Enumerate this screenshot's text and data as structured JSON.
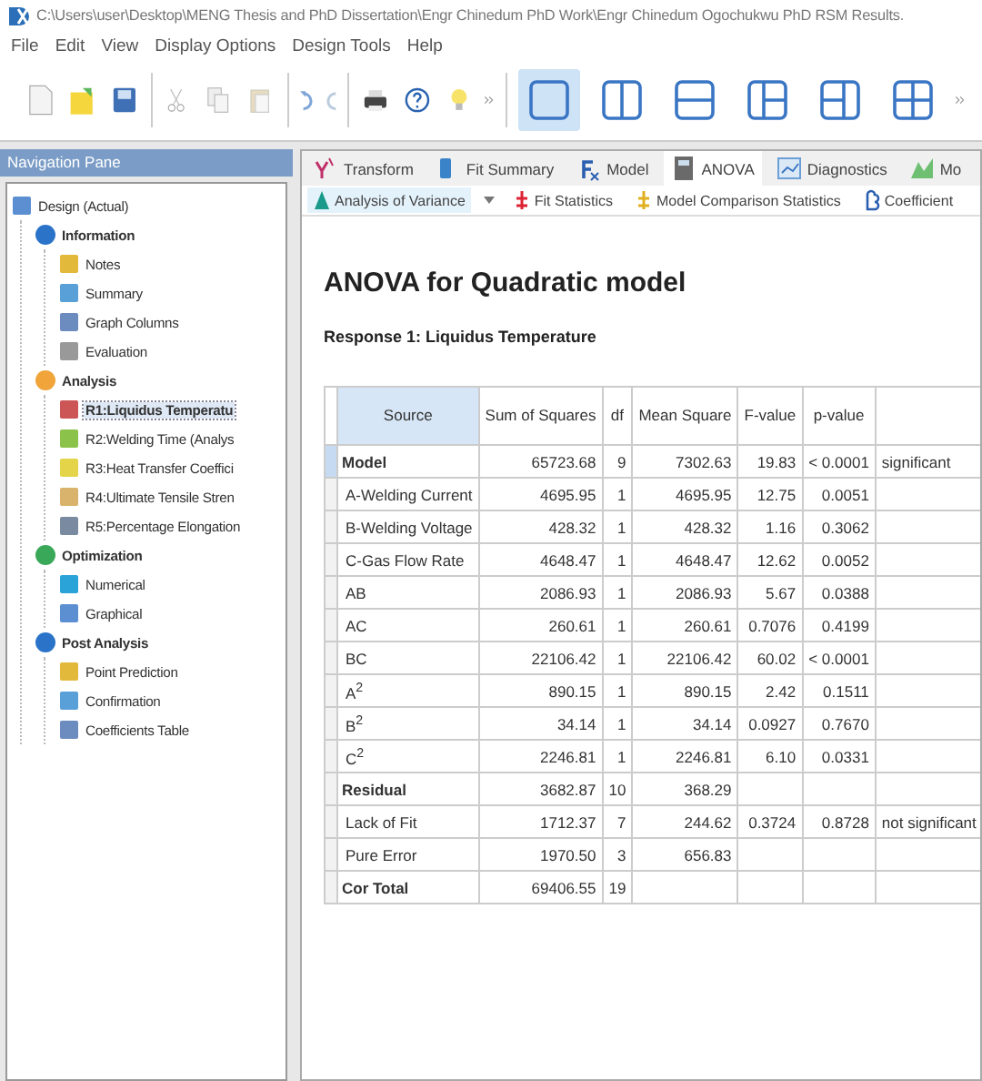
{
  "window": {
    "title": "C:\\Users\\user\\Desktop\\MENG Thesis and PhD Dissertation\\Engr Chinedum PhD Work\\Engr Chinedum Ogochukwu PhD RSM Results."
  },
  "menu": [
    "File",
    "Edit",
    "View",
    "Display Options",
    "Design Tools",
    "Help"
  ],
  "layout_buttons": [
    {
      "selected": true
    },
    {
      "selected": false
    },
    {
      "selected": false
    },
    {
      "selected": false
    },
    {
      "selected": false
    },
    {
      "selected": false
    }
  ],
  "navigation": {
    "title": "Navigation Pane",
    "tree": [
      {
        "label": "Design (Actual)",
        "selected": false,
        "bold": false,
        "children": [
          {
            "label": "Information",
            "selected": false,
            "bold": true,
            "children": [
              {
                "label": "Notes",
                "selected": false,
                "bold": false
              },
              {
                "label": "Summary",
                "selected": false,
                "bold": false
              },
              {
                "label": "Graph Columns",
                "selected": false,
                "bold": false
              },
              {
                "label": "Evaluation",
                "selected": false,
                "bold": false
              }
            ]
          },
          {
            "label": "Analysis",
            "selected": false,
            "bold": true,
            "children": [
              {
                "label": "R1:Liquidus Temperatu",
                "selected": true,
                "bold": true
              },
              {
                "label": "R2:Welding Time (Analys",
                "selected": false,
                "bold": false
              },
              {
                "label": "R3:Heat Transfer Coeffici",
                "selected": false,
                "bold": false
              },
              {
                "label": "R4:Ultimate Tensile Stren",
                "selected": false,
                "bold": false
              },
              {
                "label": "R5:Percentage Elongation",
                "selected": false,
                "bold": false
              }
            ]
          },
          {
            "label": "Optimization",
            "selected": false,
            "bold": true,
            "children": [
              {
                "label": "Numerical",
                "selected": false,
                "bold": false
              },
              {
                "label": "Graphical",
                "selected": false,
                "bold": false
              }
            ]
          },
          {
            "label": "Post Analysis",
            "selected": false,
            "bold": true,
            "children": [
              {
                "label": "Point Prediction",
                "selected": false,
                "bold": false
              },
              {
                "label": "Confirmation",
                "selected": false,
                "bold": false
              },
              {
                "label": "Coefficients Table",
                "selected": false,
                "bold": false
              }
            ]
          }
        ]
      }
    ]
  },
  "tabs": [
    {
      "label": "Transform",
      "selected": false
    },
    {
      "label": "Fit Summary",
      "selected": false
    },
    {
      "label": "Model",
      "selected": false
    },
    {
      "label": "ANOVA",
      "selected": true
    },
    {
      "label": "Diagnostics",
      "selected": false
    },
    {
      "label": "Mo",
      "selected": false
    }
  ],
  "subtabs": [
    {
      "label": "Analysis of Variance",
      "selected": true,
      "dropdown": true
    },
    {
      "label": "Fit Statistics",
      "selected": false,
      "dropdown": false
    },
    {
      "label": "Model Comparison Statistics",
      "selected": false,
      "dropdown": false
    },
    {
      "label": "Coefficient",
      "selected": false,
      "dropdown": false
    }
  ],
  "report": {
    "heading": "ANOVA for Quadratic model",
    "subheading": "Response 1: Liquidus Temperature",
    "table": {
      "columns": [
        "Source",
        "Sum of Squares",
        "df",
        "Mean Square",
        "F-value",
        "p-value"
      ],
      "rows": [
        {
          "kind": "group",
          "selected": true,
          "cells": [
            "Model",
            "65723.68",
            "9",
            "7302.63",
            "19.83",
            "< 0.0001",
            "significant"
          ]
        },
        {
          "kind": "term",
          "selected": false,
          "cells": [
            "A-Welding Current",
            "4695.95",
            "1",
            "4695.95",
            "12.75",
            "0.0051",
            ""
          ]
        },
        {
          "kind": "term",
          "selected": false,
          "cells": [
            "B-Welding Voltage",
            "428.32",
            "1",
            "428.32",
            "1.16",
            "0.3062",
            ""
          ]
        },
        {
          "kind": "term",
          "selected": false,
          "cells": [
            "C-Gas Flow Rate",
            "4648.47",
            "1",
            "4648.47",
            "12.62",
            "0.0052",
            ""
          ]
        },
        {
          "kind": "term",
          "selected": false,
          "cells": [
            "AB",
            "2086.93",
            "1",
            "2086.93",
            "5.67",
            "0.0388",
            ""
          ]
        },
        {
          "kind": "term",
          "selected": false,
          "cells": [
            "AC",
            "260.61",
            "1",
            "260.61",
            "0.7076",
            "0.4199",
            ""
          ]
        },
        {
          "kind": "term",
          "selected": false,
          "cells": [
            "BC",
            "22106.42",
            "1",
            "22106.42",
            "60.02",
            "< 0.0001",
            ""
          ]
        },
        {
          "kind": "term",
          "selected": false,
          "cells": [
            "A$^{2}$",
            "890.15",
            "1",
            "890.15",
            "2.42",
            "0.1511",
            ""
          ]
        },
        {
          "kind": "term",
          "selected": false,
          "cells": [
            "B$^{2}$",
            "34.14",
            "1",
            "34.14",
            "0.0927",
            "0.7670",
            ""
          ]
        },
        {
          "kind": "term",
          "selected": false,
          "cells": [
            "C$^{2}$",
            "2246.81",
            "1",
            "2246.81",
            "6.10",
            "0.0331",
            ""
          ]
        },
        {
          "kind": "group",
          "selected": false,
          "cells": [
            "Residual",
            "3682.87",
            "10",
            "368.29",
            "",
            "",
            ""
          ]
        },
        {
          "kind": "term",
          "selected": false,
          "cells": [
            "Lack of Fit",
            "1712.37",
            "7",
            "244.62",
            "0.3724",
            "0.8728",
            "not significant"
          ]
        },
        {
          "kind": "term",
          "selected": false,
          "cells": [
            "Pure Error",
            "1970.50",
            "3",
            "656.83",
            "",
            "",
            ""
          ]
        },
        {
          "kind": "group",
          "selected": false,
          "cells": [
            "Cor Total",
            "69406.55",
            "19",
            "",
            "",
            "",
            ""
          ]
        }
      ]
    }
  }
}
